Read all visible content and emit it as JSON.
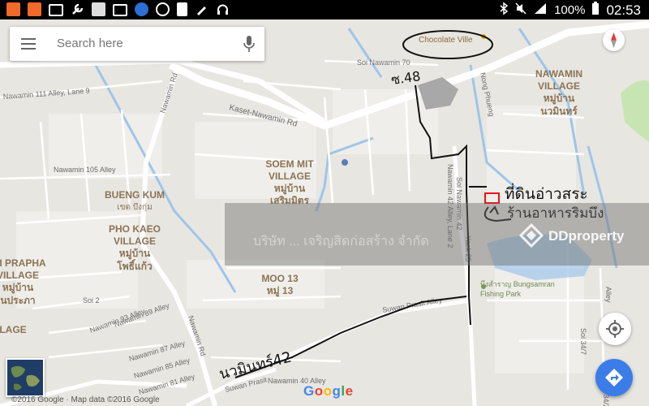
{
  "status_bar": {
    "battery": "100%",
    "time": "02:53"
  },
  "search": {
    "placeholder": "Search here"
  },
  "map": {
    "area_labels": {
      "nawamin_village_en": "NAWAMIN",
      "nawamin_village_en2": "VILLAGE",
      "nawamin_village_th": "หมู่บ้าน",
      "nawamin_village_th2": "นวมินทร์",
      "soem_mit_en": "SOEM MIT",
      "soem_mit_en2": "VILLAGE",
      "soem_mit_th": "หมู่บ้าน",
      "soem_mit_th2": "เสริมมิตร",
      "bueng_kum_en": "BUENG KUM",
      "bueng_kum_th": "เขต บึงกุ่ม",
      "pho_kaeo_en": "PHO KAEO",
      "pho_kaeo_en2": "VILLAGE",
      "pho_kaeo_th": "หมู่บ้าน",
      "pho_kaeo_th2": "โพธิ์แก้ว",
      "pracha_en": "I PRAPHA",
      "pracha_en2": "VILLAGE",
      "pracha_th": "หมู่บ้าน",
      "pracha_th2": "นประภา",
      "lage": "LAGE",
      "moo13_en": "MOO 13",
      "moo13_th": "หมู่ 13"
    },
    "road_labels": {
      "kaset_nawamin": "Kaset-Nawamin Rd",
      "soi_nawamin_70": "Soi Nawamin 70",
      "nawamin_111": "Nawamin 111 Alley, Lane 9",
      "nawamin_105": "Nawamin 105 Alley",
      "nawamin_rd_top": "Nawamin Rd",
      "nawamin_rd_bottom": "Nawamin Rd",
      "soi_nawamin_42": "Soi Nawamin 42",
      "yaek_25": "Yaek 25",
      "nawamin_42_lane2": "Nawamin 42 Alley, Lane 2",
      "suwan_prasit_alley": "Suwan Prasit Alley",
      "suwan_prasit_2": "Suwan Prasit",
      "soi_2": "Soi 2",
      "nawamin_93": "Nawamin 93 Alley",
      "nawamin_89": "Nawamin 89 Alley",
      "nawamin_87": "Nawamin 87 Alley",
      "nawamin_85": "Nawamin 85 Alley",
      "nawamin_81": "Nawamin 81 Alley",
      "nawamin_40": "Nawamin 40 Alley",
      "nong_phueng": "Nong Phueng",
      "soi_34_7": "Soi 34/7",
      "soi_34_2": "Soi 34/2",
      "alley": "Alley"
    },
    "poi": {
      "chocolate_ville": "Chocolate Ville",
      "fishing_park_th": "บึงสำราญ Bungsamran",
      "fishing_park_en": "Fishing Park"
    },
    "handwritten": {
      "soi_48": "ซ.48",
      "site_label": "ที่ดินอ่าวสระ",
      "restaurant": "ร้านอาหารริมบึง",
      "nawamin_42": "นวมินทร์42"
    },
    "copyright": "©2016 Google · Map data ©2016 Google",
    "google_logo": [
      "G",
      "o",
      "o",
      "g",
      "l",
      "e"
    ]
  },
  "watermark": {
    "company": "บริษัท ... เจริญสิดก่อสร้าง จำกัด",
    "brand": "DDproperty"
  },
  "colors": {
    "map_bg": "#e8e6e1",
    "road": "#ffffff",
    "water": "#9fc5ea",
    "park": "#c6e5b3",
    "accent": "#3b7de8"
  }
}
